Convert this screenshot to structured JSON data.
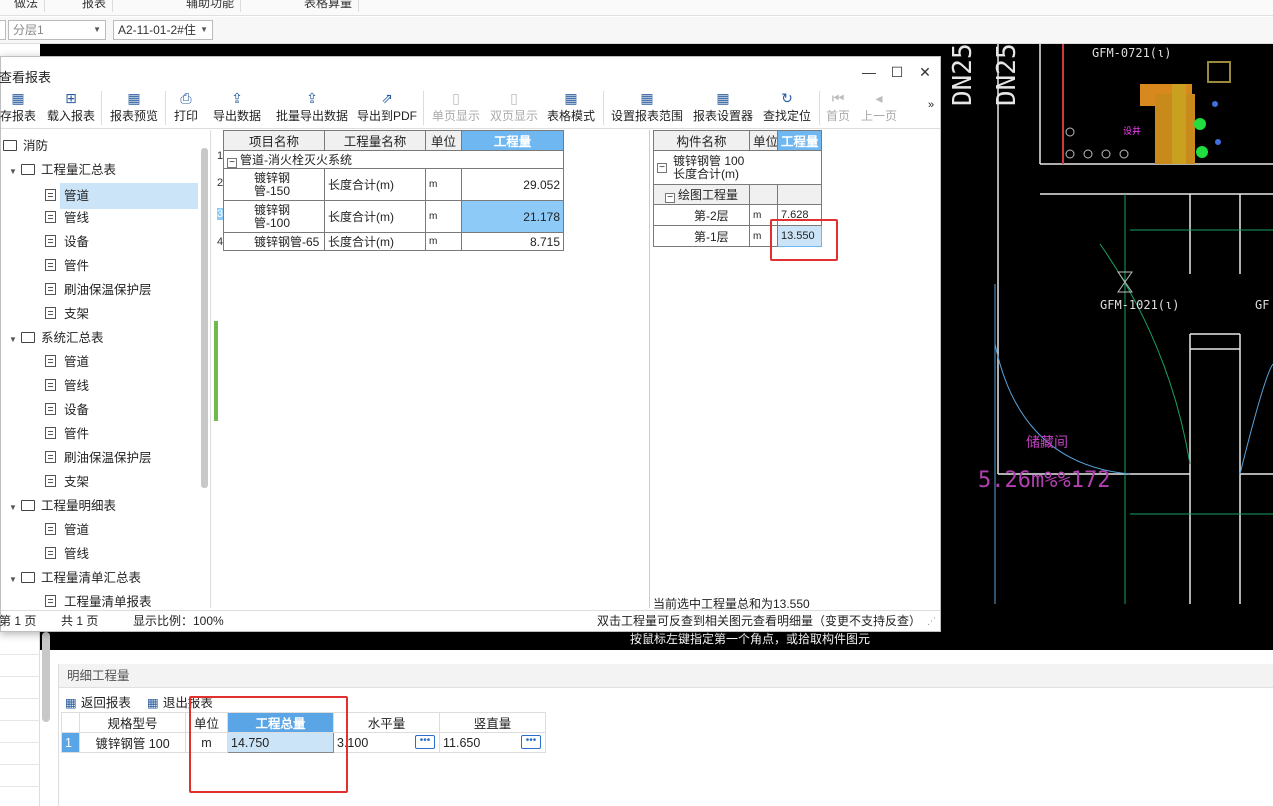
{
  "top_menu": [
    "做法",
    "报表",
    "辅助功能",
    "表格算量"
  ],
  "toolbar2": {
    "floor_combo": "分层1",
    "component_combo": "A2-11-01-2#住"
  },
  "cad": {
    "labels": [
      "DN25",
      "DN25",
      "GFM-0721(ι)",
      "GFM-1021(ι)",
      "GF",
      "设井",
      "储藏间",
      "5.26m%%172"
    ],
    "hint": "按鼠标左键指定第一个角点，或拾取构件图元"
  },
  "dialog": {
    "title": "查看报表",
    "window_buttons": [
      "—",
      "☐",
      "✕"
    ],
    "toolbar": [
      {
        "label": "存报表",
        "icon": "save-icon",
        "enabled": true
      },
      {
        "label": "载入报表",
        "icon": "load-icon",
        "enabled": true
      },
      {
        "label": "报表预览",
        "icon": "preview-icon",
        "enabled": true
      },
      {
        "label": "打印",
        "icon": "print-icon",
        "enabled": true
      },
      {
        "label": "导出数据",
        "icon": "export-icon",
        "enabled": true
      },
      {
        "label": "批量导出数据",
        "icon": "batch-export-icon",
        "enabled": true
      },
      {
        "label": "导出到PDF",
        "icon": "pdf-icon",
        "enabled": true
      },
      {
        "label": "单页显示",
        "icon": "single-page-icon",
        "enabled": false
      },
      {
        "label": "双页显示",
        "icon": "double-page-icon",
        "enabled": false
      },
      {
        "label": "表格模式",
        "icon": "table-mode-icon",
        "enabled": true
      },
      {
        "label": "设置报表范围",
        "icon": "range-icon",
        "enabled": true
      },
      {
        "label": "报表设置器",
        "icon": "settings-icon",
        "enabled": true
      },
      {
        "label": "查找定位",
        "icon": "locate-icon",
        "enabled": true
      },
      {
        "label": "首页",
        "icon": "first-page-icon",
        "enabled": false
      },
      {
        "label": "上一页",
        "icon": "prev-page-icon",
        "enabled": false
      }
    ],
    "overflow": "»",
    "tree": [
      {
        "label": "消防",
        "type": "folder",
        "level": 0,
        "toggle": ""
      },
      {
        "label": "工程量汇总表",
        "type": "folder",
        "level": 1,
        "toggle": "▼"
      },
      {
        "label": "管道",
        "type": "doc",
        "level": 2,
        "selected": true
      },
      {
        "label": "管线",
        "type": "doc",
        "level": 2
      },
      {
        "label": "设备",
        "type": "doc",
        "level": 2
      },
      {
        "label": "管件",
        "type": "doc",
        "level": 2
      },
      {
        "label": "刷油保温保护层",
        "type": "doc",
        "level": 2
      },
      {
        "label": "支架",
        "type": "doc",
        "level": 2
      },
      {
        "label": "系统汇总表",
        "type": "folder",
        "level": 1,
        "toggle": "▼"
      },
      {
        "label": "管道",
        "type": "doc",
        "level": 2
      },
      {
        "label": "管线",
        "type": "doc",
        "level": 2
      },
      {
        "label": "设备",
        "type": "doc",
        "level": 2
      },
      {
        "label": "管件",
        "type": "doc",
        "level": 2
      },
      {
        "label": "刷油保温保护层",
        "type": "doc",
        "level": 2
      },
      {
        "label": "支架",
        "type": "doc",
        "level": 2
      },
      {
        "label": "工程量明细表",
        "type": "folder",
        "level": 1,
        "toggle": "▼"
      },
      {
        "label": "管道",
        "type": "doc",
        "level": 2
      },
      {
        "label": "管线",
        "type": "doc",
        "level": 2
      },
      {
        "label": "工程量清单汇总表",
        "type": "folder",
        "level": 1,
        "toggle": "▼"
      },
      {
        "label": "工程量清单报表",
        "type": "doc",
        "level": 2
      }
    ],
    "main_table": {
      "headers": [
        "项目名称",
        "工程量名称",
        "单位",
        "工程量"
      ],
      "group_row": "管道-消火栓灭火系统",
      "rows": [
        {
          "num": "2",
          "name": "镀锌钢管-150",
          "qty_name": "长度合计(m)",
          "unit": "m",
          "value": "29.052"
        },
        {
          "num": "3",
          "name": "镀锌钢管-100",
          "qty_name": "长度合计(m)",
          "unit": "m",
          "value": "21.178",
          "selected": true
        },
        {
          "num": "4",
          "name": "镀锌钢管-65",
          "qty_name": "长度合计(m)",
          "unit": "m",
          "value": "8.715"
        }
      ],
      "group_num": "1"
    },
    "right_table": {
      "headers": [
        "构件名称",
        "单位",
        "工程量"
      ],
      "title_line1": "镀锌钢管 100",
      "title_line2": "长度合计(m)",
      "subgroup": "绘图工程量",
      "rows": [
        {
          "name": "第-2层",
          "unit": "m",
          "value": "7.628"
        },
        {
          "name": "第-1层",
          "unit": "m",
          "value": "13.550",
          "selected": true
        }
      ]
    },
    "selected_total_text": "当前选中工程量总和为13.550",
    "status": {
      "page": "第 1 页",
      "total": "共 1 页",
      "zoom": "显示比例：100%",
      "hint": "双击工程量可反查到相关图元查看明细量（变更不支持反查）"
    }
  },
  "detail": {
    "title": "明细工程量",
    "buttons": [
      "返回报表",
      "退出报表"
    ],
    "headers": [
      "规格型号",
      "单位",
      "工程总量",
      "水平量",
      "竖直量"
    ],
    "rows": [
      {
        "num": "1",
        "spec": "镀锌钢管 100",
        "unit": "m",
        "total": "14.750",
        "horizontal": "3.100",
        "vertical": "11.650"
      }
    ]
  },
  "colors": {
    "accent": "#6fb7f0",
    "selection": "#8ecaf8",
    "red_annotation": "#e03030",
    "cad_background": "#000000"
  }
}
